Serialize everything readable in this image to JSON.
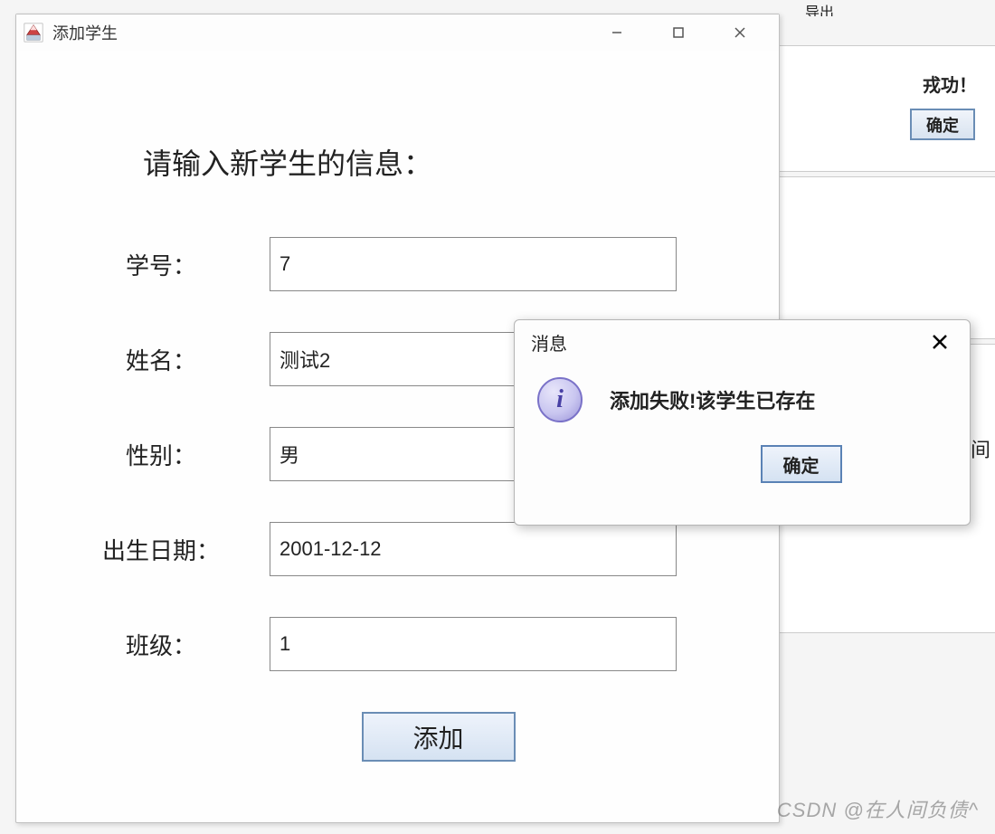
{
  "bg": {
    "menu_items": [
      "导出"
    ],
    "right_text": "戎功！",
    "right_btn": "确定",
    "right_char": "间"
  },
  "window": {
    "title": "添加学生",
    "heading": "请输入新学生的信息：",
    "fields": {
      "id": {
        "label": "学号：",
        "value": "7"
      },
      "name": {
        "label": "姓名：",
        "value": "测试2"
      },
      "gender": {
        "label": "性别：",
        "value": "男"
      },
      "birth": {
        "label": "出生日期：",
        "value": "2001-12-12"
      },
      "class": {
        "label": "班级：",
        "value": "1"
      }
    },
    "submit": "添加"
  },
  "dialog": {
    "title": "消息",
    "message": "添加失败!该学生已存在",
    "ok": "确定"
  },
  "watermark": "CSDN @在人间负债^"
}
